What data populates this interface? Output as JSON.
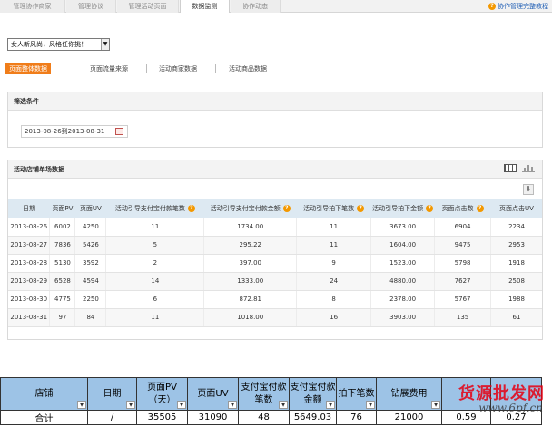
{
  "tabs": [
    {
      "label": "管理协作商家",
      "active": false
    },
    {
      "label": "管理协议",
      "active": false
    },
    {
      "label": "管理活动页面",
      "active": false
    },
    {
      "label": "数据监测",
      "active": true
    },
    {
      "label": "协作动态",
      "active": false
    }
  ],
  "help_link": "协作管理完整教程",
  "store_select": {
    "value": "女人新风尚，风格任你挑！"
  },
  "subnav": [
    {
      "label": "页面整体数据",
      "active": true
    },
    {
      "label": "页面流量来源",
      "active": false
    },
    {
      "label": "活动商家数据",
      "active": false
    },
    {
      "label": "活动商品数据",
      "active": false
    }
  ],
  "filter": {
    "title": "筛选条件",
    "date_range": "2013-08-26到2013-08-31"
  },
  "store_data": {
    "title": "活动店铺单场数据",
    "headers": [
      "日期",
      "页面PV",
      "页面UV",
      "活动引导支付宝付款笔数",
      "活动引导支付宝付款金额",
      "活动引导拍下笔数",
      "活动引导拍下金额",
      "页面点击数",
      "页面点击UV"
    ],
    "help_cols": [
      3,
      4,
      5,
      6,
      7
    ],
    "rows": [
      [
        "2013-08-26",
        "6002",
        "4250",
        "11",
        "1734.00",
        "11",
        "3673.00",
        "6904",
        "2234"
      ],
      [
        "2013-08-27",
        "7836",
        "5426",
        "5",
        "295.22",
        "11",
        "1604.00",
        "9475",
        "2953"
      ],
      [
        "2013-08-28",
        "5130",
        "3592",
        "2",
        "397.00",
        "9",
        "1523.00",
        "5798",
        "1918"
      ],
      [
        "2013-08-29",
        "6528",
        "4594",
        "14",
        "1333.00",
        "24",
        "4880.00",
        "7627",
        "2508"
      ],
      [
        "2013-08-30",
        "4775",
        "2250",
        "6",
        "872.81",
        "8",
        "2378.00",
        "5767",
        "1988"
      ],
      [
        "2013-08-31",
        "97",
        "84",
        "11",
        "1018.00",
        "16",
        "3903.00",
        "135",
        "61"
      ]
    ]
  },
  "spreadsheet": {
    "headers": [
      "店铺",
      "日期",
      "页面PV（天）",
      "页面UV",
      "支付宝付款笔数",
      "支付宝付款金额",
      "拍下笔数",
      "钻展费用",
      "",
      ""
    ],
    "total_row": [
      "合计",
      "/",
      "35505",
      "31090",
      "48",
      "5649.03",
      "76",
      "21000",
      "0.59",
      "0.27"
    ]
  },
  "watermark": {
    "main": "货源批发网",
    "sub": "www.6pf.cn"
  },
  "colors": {
    "accent": "#f07d1a",
    "header_bg": "#dde9f2",
    "sheet_header": "#9dc3e6",
    "help_icon": "#f39800"
  }
}
